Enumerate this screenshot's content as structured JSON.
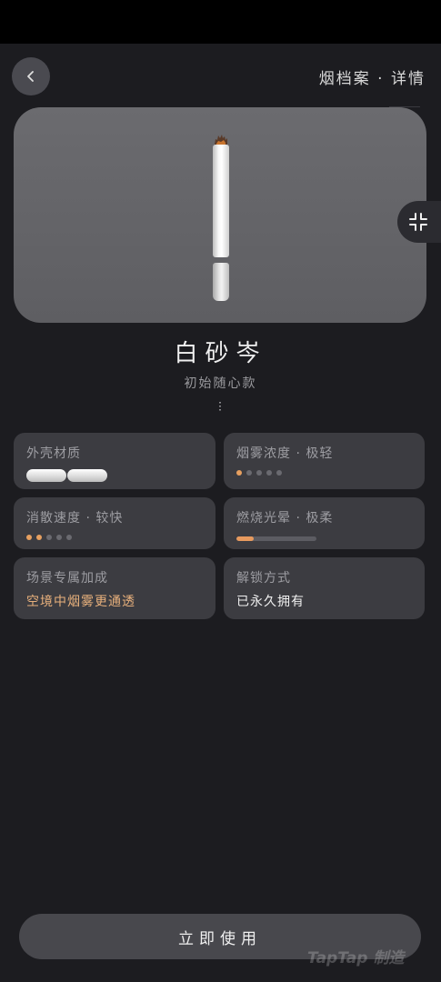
{
  "header": {
    "back_icon": "chevron-left-icon",
    "title": "烟档案 · 详情"
  },
  "hero": {
    "collapse_icon": "collapse-icon"
  },
  "item": {
    "name": "白砂岑",
    "subtitle": "初始随心款"
  },
  "cards": {
    "shell": {
      "label": "外壳材质",
      "pill_count": 2
    },
    "smoke_density": {
      "label": "烟雾浓度 · 极轻",
      "dots_total": 5,
      "dots_active": 1
    },
    "dispersion": {
      "label": "消散速度 · 较快",
      "dots_total": 5,
      "dots_active": 2
    },
    "glow": {
      "label": "燃烧光晕 · 极柔",
      "fill_fraction": 0.22
    },
    "scene_bonus": {
      "label": "场景专属加成",
      "value": "空境中烟雾更通透"
    },
    "unlock": {
      "label": "解锁方式",
      "value": "已永久拥有"
    }
  },
  "actions": {
    "use_label": "立即使用"
  },
  "watermark": "TapTap 制造",
  "colors": {
    "accent": "#e7a060",
    "accent_text": "#e7b07c",
    "card_bg": "#3c3c41",
    "page_bg": "#1c1c20"
  }
}
